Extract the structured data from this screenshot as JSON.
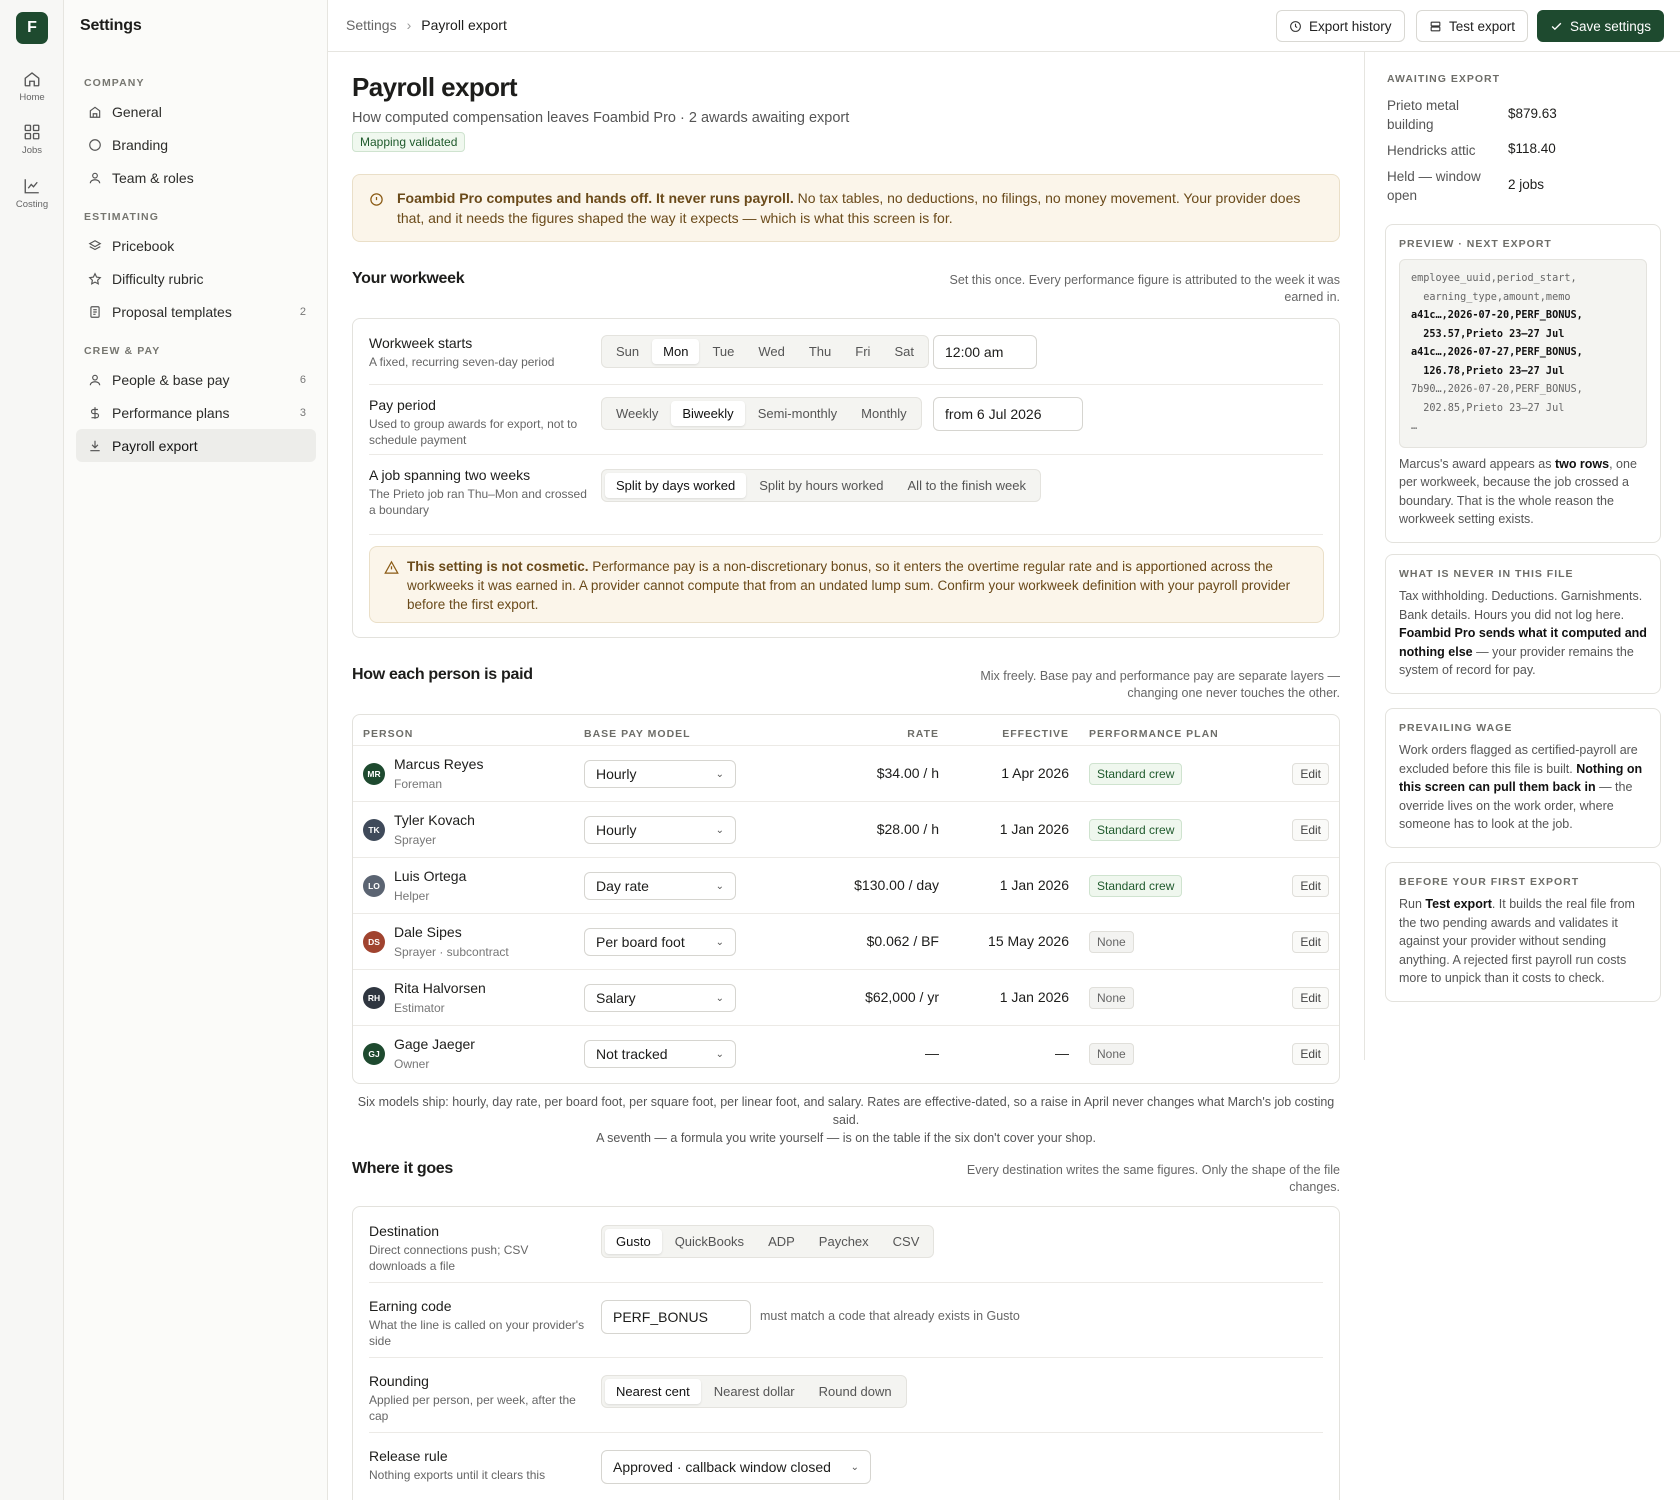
{
  "app": {
    "logo_letter": "F",
    "sidebar_title": "Settings"
  },
  "rail": [
    {
      "label": "Home",
      "icon": "home-icon"
    },
    {
      "label": "Jobs",
      "icon": "grid-icon"
    },
    {
      "label": "Costing",
      "icon": "chart-icon"
    }
  ],
  "sidebar": {
    "groups": [
      {
        "label": "COMPANY",
        "items": [
          {
            "label": "General",
            "icon": "building-icon",
            "count": ""
          },
          {
            "label": "Branding",
            "icon": "circle-icon",
            "count": ""
          },
          {
            "label": "Team & roles",
            "icon": "user-icon",
            "count": ""
          }
        ]
      },
      {
        "label": "ESTIMATING",
        "items": [
          {
            "label": "Pricebook",
            "icon": "layers-icon",
            "count": ""
          },
          {
            "label": "Difficulty rubric",
            "icon": "star-icon",
            "count": ""
          },
          {
            "label": "Proposal templates",
            "icon": "document-icon",
            "count": "2"
          }
        ]
      },
      {
        "label": "CREW & PAY",
        "items": [
          {
            "label": "People & base pay",
            "icon": "user-icon",
            "count": "6"
          },
          {
            "label": "Performance plans",
            "icon": "dollar-icon",
            "count": "3"
          },
          {
            "label": "Payroll export",
            "icon": "download-icon",
            "count": "",
            "active": true
          }
        ]
      }
    ]
  },
  "topbar": {
    "crumb_root": "Settings",
    "crumb_current": "Payroll export",
    "export_history": "Export history",
    "test_export": "Test export",
    "save": "Save settings"
  },
  "page": {
    "title": "Payroll export",
    "subtitle": "How computed compensation leaves Foambid Pro · 2 awards awaiting export",
    "badge": "Mapping validated",
    "notice_bold": "Foambid Pro computes and hands off. It never runs payroll.",
    "notice_text": " No tax tables, no deductions, no filings, no money movement. Your provider does that, and it needs the figures shaped the way it expects — which is what this screen is for."
  },
  "workweek": {
    "heading": "Your workweek",
    "note": "Set this once. Every performance figure is attributed to the week it was earned in.",
    "starts_label": "Workweek starts",
    "starts_desc": "A fixed, recurring seven-day period",
    "days": [
      "Sun",
      "Mon",
      "Tue",
      "Wed",
      "Thu",
      "Fri",
      "Sat"
    ],
    "day_selected": 1,
    "start_time": "12:00 am",
    "period_label": "Pay period",
    "period_desc": "Used to group awards for export, not to schedule payment",
    "periods": [
      "Weekly",
      "Biweekly",
      "Semi-monthly",
      "Monthly"
    ],
    "period_selected": 1,
    "period_from": "from 6 Jul 2026",
    "span_label": "A job spanning two weeks",
    "span_desc": "The Prieto job ran Thu–Mon and crossed a boundary",
    "span_options": [
      "Split by days worked",
      "Split by hours worked",
      "All to the finish week"
    ],
    "span_selected": 0,
    "warn_bold": "This setting is not cosmetic.",
    "warn_text": " Performance pay is a non-discretionary bonus, so it enters the overtime regular rate and is apportioned across the workweeks it was earned in. A provider cannot compute that from an undated lump sum. Confirm your workweek definition with your payroll provider before the first export."
  },
  "people": {
    "heading": "How each person is paid",
    "note": "Mix freely. Base pay and performance pay are separate layers — changing one never touches the other.",
    "columns": [
      "PERSON",
      "BASE PAY MODEL",
      "RATE",
      "EFFECTIVE",
      "PERFORMANCE PLAN"
    ],
    "edit_label": "Edit",
    "rows": [
      {
        "initials": "MR",
        "color": "#1e4a2f",
        "name": "Marcus Reyes",
        "role": "Foreman",
        "model": "Hourly",
        "rate": "$34.00 / h",
        "effective": "1 Apr 2026",
        "plan": "Standard crew",
        "plan_kind": "std"
      },
      {
        "initials": "TK",
        "color": "#3f4a5a",
        "name": "Tyler Kovach",
        "role": "Sprayer",
        "model": "Hourly",
        "rate": "$28.00 / h",
        "effective": "1 Jan 2026",
        "plan": "Standard crew",
        "plan_kind": "std"
      },
      {
        "initials": "LO",
        "color": "#5b6472",
        "name": "Luis Ortega",
        "role": "Helper",
        "model": "Day rate",
        "rate": "$130.00 / day",
        "effective": "1 Jan 2026",
        "plan": "Standard crew",
        "plan_kind": "std"
      },
      {
        "initials": "DS",
        "color": "#a0432f",
        "name": "Dale Sipes",
        "role": "Sprayer · subcontract",
        "model": "Per board foot",
        "rate": "$0.062 / BF",
        "effective": "15 May 2026",
        "plan": "None",
        "plan_kind": "none"
      },
      {
        "initials": "RH",
        "color": "#2f3640",
        "name": "Rita Halvorsen",
        "role": "Estimator",
        "model": "Salary",
        "rate": "$62,000 / yr",
        "effective": "1 Jan 2026",
        "plan": "None",
        "plan_kind": "none"
      },
      {
        "initials": "GJ",
        "color": "#1e4a2f",
        "name": "Gage Jaeger",
        "role": "Owner",
        "model": "Not tracked",
        "rate": "—",
        "effective": "—",
        "plan": "None",
        "plan_kind": "none"
      }
    ],
    "footnote_1": "Six models ship: hourly, day rate, per board foot, per square foot, per linear foot, and salary. Rates are effective-dated, so a raise in April never changes what March's job costing said.",
    "footnote_2": "A seventh — a formula you write yourself — is on the table if the six don't cover your shop."
  },
  "destination": {
    "heading": "Where it goes",
    "note": "Every destination writes the same figures. Only the shape of the file changes.",
    "dest_label": "Destination",
    "dest_desc": "Direct connections push; CSV downloads a file",
    "dest_options": [
      "Gusto",
      "QuickBooks",
      "ADP",
      "Paychex",
      "CSV"
    ],
    "dest_selected": 0,
    "code_label": "Earning code",
    "code_desc": "What the line is called on your provider's side",
    "code_value": "PERF_BONUS",
    "code_hint": "must match a code that already exists in Gusto",
    "round_label": "Rounding",
    "round_desc": "Applied per person, per week, after the cap",
    "round_options": [
      "Nearest cent",
      "Nearest dollar",
      "Round down"
    ],
    "round_selected": 0,
    "release_label": "Release rule",
    "release_desc": "Nothing exports until it clears this",
    "release_value": "Approved · callback window closed"
  },
  "right": {
    "awaiting_h": "AWAITING EXPORT",
    "awaiting": [
      {
        "label": "Prieto metal building",
        "value": "$879.63"
      },
      {
        "label": "Hendricks attic",
        "value": "$118.40"
      },
      {
        "label": "Held — window open",
        "value": "2 jobs"
      }
    ],
    "preview_h": "PREVIEW · NEXT EXPORT",
    "code_lines": [
      {
        "text": "employee_uuid,period_start,",
        "bold": false
      },
      {
        "text": "  earning_type,amount,memo",
        "bold": false
      },
      {
        "text": "a41c…,2026-07-20,PERF_BONUS,",
        "bold": true
      },
      {
        "text": "  253.57,Prieto 23–27 Jul",
        "bold": true
      },
      {
        "text": "a41c…,2026-07-27,PERF_BONUS,",
        "bold": true
      },
      {
        "text": "  126.78,Prieto 23–27 Jul",
        "bold": true
      },
      {
        "text": "7b90…,2026-07-20,PERF_BONUS,",
        "bold": false
      },
      {
        "text": "  202.85,Prieto 23–27 Jul",
        "bold": false
      },
      {
        "text": "…",
        "bold": false
      }
    ],
    "preview_p1": "Marcus's award appears as ",
    "preview_b": "two rows",
    "preview_p2": ", one per workweek, because the job crossed a boundary. That is the whole reason the workweek setting exists.",
    "never_h": "WHAT IS NEVER IN THIS FILE",
    "never_p1": "Tax withholding. Deductions. Garnishments. Bank details. Hours you did not log here. ",
    "never_b": "Foambid Pro sends what it computed and nothing else",
    "never_p2": " — your provider remains the system of record for pay.",
    "wage_h": "PREVAILING WAGE",
    "wage_p1": "Work orders flagged as certified-payroll are excluded before this file is built. ",
    "wage_b": "Nothing on this screen can pull them back in",
    "wage_p2": " — the override lives on the work order, where someone has to look at the job.",
    "first_h": "BEFORE YOUR FIRST EXPORT",
    "first_p1": "Run ",
    "first_b": "Test export",
    "first_p2": ". It builds the real file from the two pending awards and validates it against your provider without sending anything. A rejected first payroll run costs more to unpick than it costs to check."
  }
}
